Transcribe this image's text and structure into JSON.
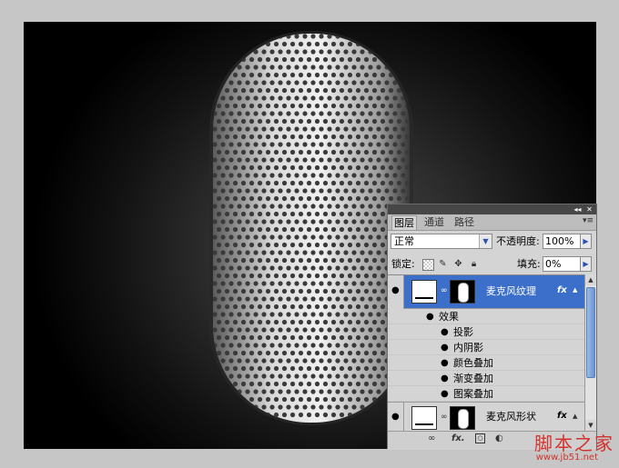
{
  "panel": {
    "tabs": [
      {
        "label": "图层",
        "active": true
      },
      {
        "label": "通道",
        "active": false
      },
      {
        "label": "路径",
        "active": false
      }
    ],
    "blend_mode": "正常",
    "opacity_label": "不透明度:",
    "opacity_value": "100%",
    "lock_label": "锁定:",
    "fill_label": "填充:",
    "fill_value": "0%",
    "layers": [
      {
        "name": "麦克风纹理",
        "selected": true,
        "effects_label": "效果",
        "effects": [
          "投影",
          "内阴影",
          "颜色叠加",
          "渐变叠加",
          "图案叠加"
        ]
      },
      {
        "name": "麦克风形状",
        "selected": false
      }
    ],
    "fx_label": "fx",
    "bottom_fx_label": "fx."
  },
  "icons": {
    "collapse": "double-chevron-left-icon",
    "close": "close-icon",
    "menu": "panel-menu-icon",
    "visibility": "eye-icon",
    "link": "chain-link-icon",
    "lock_transparent": "lock-transparency-icon",
    "lock_image": "lock-brush-icon",
    "lock_position": "move-icon",
    "lock_all": "lock-icon"
  },
  "colors": {
    "selection": "#3b6fc9",
    "canvas_bg": "#000000",
    "app_bg": "#c6c6c6"
  },
  "watermark": {
    "main": "脚本之家",
    "url": "www.jb51.net"
  }
}
